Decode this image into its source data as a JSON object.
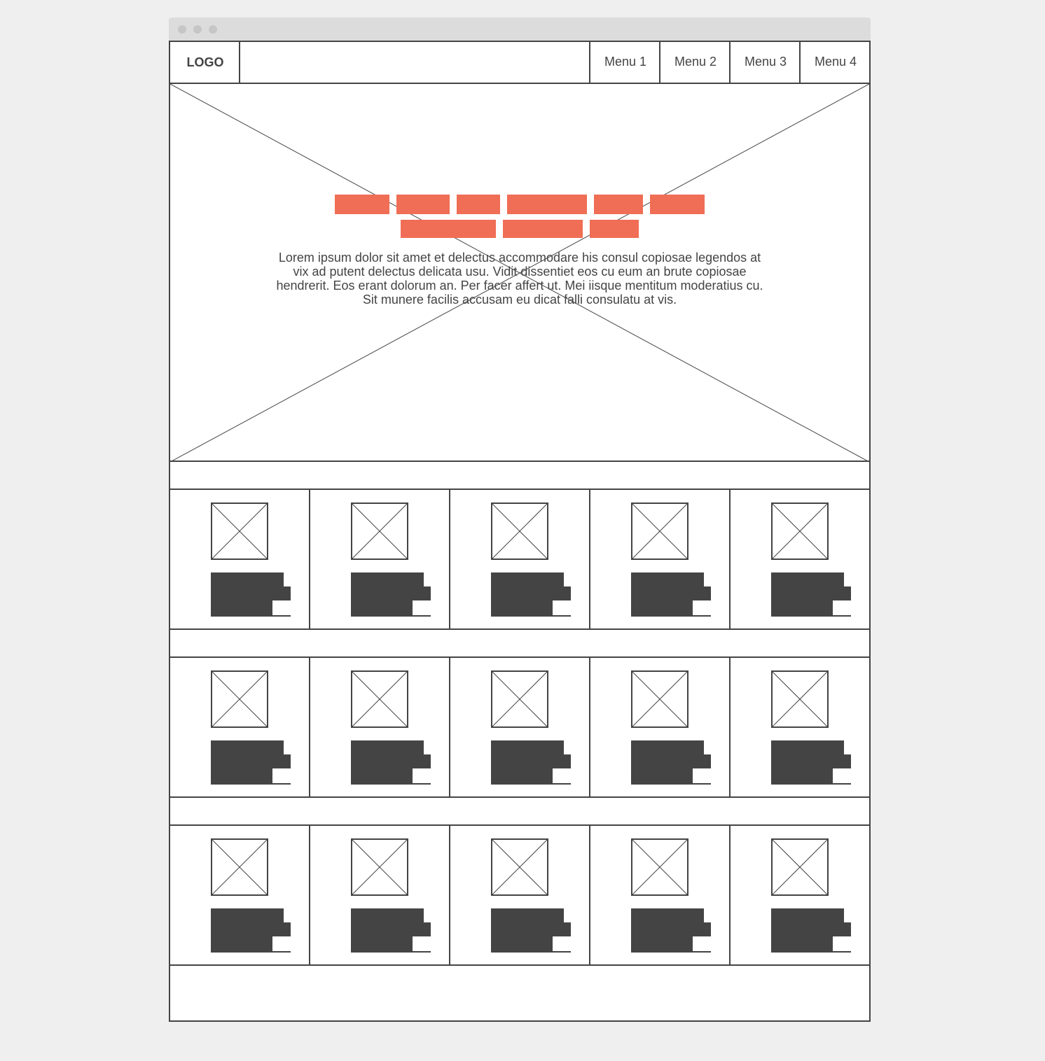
{
  "header": {
    "logo": "LOGO",
    "menu": [
      "Menu 1",
      "Menu 2",
      "Menu 3",
      "Menu 4"
    ]
  },
  "hero": {
    "headline_placeholder": "redacted headline (orange bars)",
    "body": "Lorem ipsum dolor sit amet et delectus accommodare his consul copiosae legendos at vix ad putent delectus delicata usu. Vidit dissentiet eos cu eum an brute copiosae hendrerit. Eos erant dolorum an. Per facer affert ut. Mei iisque mentitum moderatius cu. Sit munere facilis accusam eu dicat falli consulatu at vis."
  },
  "colors": {
    "accent": "#f06e55",
    "ink": "#444444",
    "background": "#efefef",
    "titlebar": "#dcdcdc"
  },
  "grid": {
    "rows": 3,
    "columns": 5,
    "card_icon": "image-placeholder-icon"
  }
}
